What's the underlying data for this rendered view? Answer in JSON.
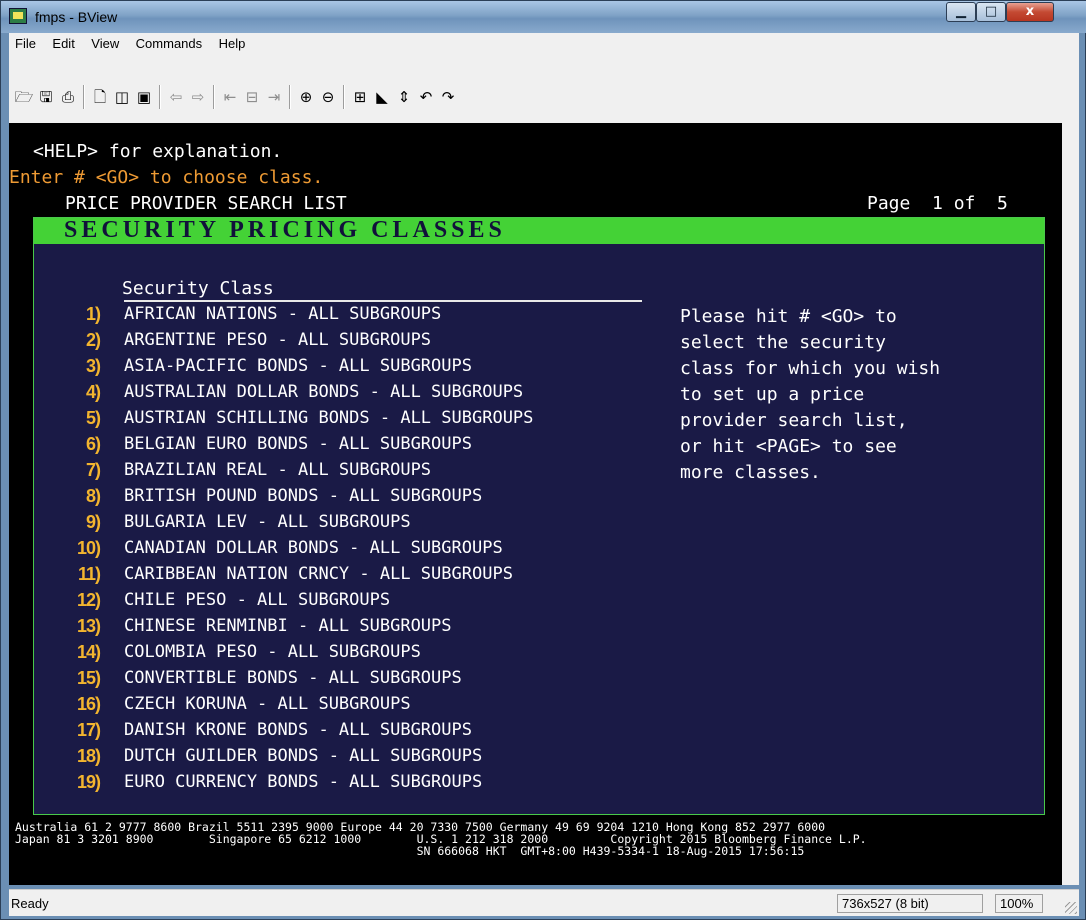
{
  "window": {
    "title": "fmps - BView",
    "minimize": "▁",
    "maximize": "□",
    "close": "x"
  },
  "menu": [
    "File",
    "Edit",
    "View",
    "Commands",
    "Help"
  ],
  "toolbar": {
    "icons": [
      {
        "name": "open-folder-icon",
        "glyph": "🗁",
        "disabled": false
      },
      {
        "name": "save-icon",
        "glyph": "🖫",
        "disabled": false
      },
      {
        "name": "print-icon",
        "glyph": "⎙",
        "disabled": false
      },
      {
        "name": "new-page-icon",
        "glyph": "🗋",
        "disabled": false
      },
      {
        "name": "window-icon",
        "glyph": "◫",
        "disabled": false
      },
      {
        "name": "fullscreen-icon",
        "glyph": "▣",
        "disabled": false
      },
      {
        "name": "back-icon",
        "glyph": "⇦",
        "disabled": true
      },
      {
        "name": "forward-icon",
        "glyph": "⇨",
        "disabled": true
      },
      {
        "name": "first-page-icon",
        "glyph": "⇤",
        "disabled": true
      },
      {
        "name": "page-icon",
        "glyph": "⊟",
        "disabled": true
      },
      {
        "name": "last-page-icon",
        "glyph": "⇥",
        "disabled": true
      },
      {
        "name": "zoom-in-icon",
        "glyph": "⊕",
        "disabled": false
      },
      {
        "name": "zoom-out-icon",
        "glyph": "⊖",
        "disabled": false
      },
      {
        "name": "resize-icon",
        "glyph": "⊞",
        "disabled": false
      },
      {
        "name": "pointer-icon",
        "glyph": "◣",
        "disabled": false
      },
      {
        "name": "scroll-icon",
        "glyph": "⇕",
        "disabled": false
      },
      {
        "name": "undo-icon",
        "glyph": "↶",
        "disabled": false
      },
      {
        "name": "redo-icon",
        "glyph": "↷",
        "disabled": false
      }
    ]
  },
  "screen": {
    "help_line": "<HELP> for explanation.",
    "enter_line": "Enter # <GO> to choose class.",
    "list_title": "PRICE PROVIDER SEARCH LIST",
    "page_info": "Page  1 of  5",
    "panel_title": "SECURITY PRICING CLASSES",
    "column_header": "Security Class",
    "items": [
      {
        "num": "1)",
        "label": "AFRICAN NATIONS - ALL SUBGROUPS"
      },
      {
        "num": "2)",
        "label": "ARGENTINE PESO - ALL SUBGROUPS"
      },
      {
        "num": "3)",
        "label": "ASIA-PACIFIC BONDS - ALL SUBGROUPS"
      },
      {
        "num": "4)",
        "label": "AUSTRALIAN DOLLAR BONDS - ALL SUBGROUPS"
      },
      {
        "num": "5)",
        "label": "AUSTRIAN SCHILLING BONDS - ALL SUBGROUPS"
      },
      {
        "num": "6)",
        "label": "BELGIAN EURO BONDS - ALL SUBGROUPS"
      },
      {
        "num": "7)",
        "label": "BRAZILIAN REAL - ALL SUBGROUPS"
      },
      {
        "num": "8)",
        "label": "BRITISH POUND BONDS - ALL SUBGROUPS"
      },
      {
        "num": "9)",
        "label": "BULGARIA LEV - ALL SUBGROUPS"
      },
      {
        "num": "10)",
        "label": "CANADIAN DOLLAR BONDS - ALL SUBGROUPS"
      },
      {
        "num": "11)",
        "label": "CARIBBEAN NATION CRNCY - ALL SUBGROUPS"
      },
      {
        "num": "12)",
        "label": "CHILE PESO - ALL SUBGROUPS"
      },
      {
        "num": "13)",
        "label": "CHINESE RENMINBI - ALL SUBGROUPS"
      },
      {
        "num": "14)",
        "label": "COLOMBIA PESO - ALL SUBGROUPS"
      },
      {
        "num": "15)",
        "label": "CONVERTIBLE BONDS - ALL SUBGROUPS"
      },
      {
        "num": "16)",
        "label": "CZECH KORUNA - ALL SUBGROUPS"
      },
      {
        "num": "17)",
        "label": "DANISH KRONE BONDS - ALL SUBGROUPS"
      },
      {
        "num": "18)",
        "label": "DUTCH GUILDER BONDS - ALL SUBGROUPS"
      },
      {
        "num": "19)",
        "label": "EURO CURRENCY BONDS - ALL SUBGROUPS"
      }
    ],
    "help_text": [
      "Please hit # <GO> to",
      "select the security",
      "class for which you wish",
      "to set up a price",
      "provider search list,",
      "or hit <PAGE> to see",
      "more classes."
    ],
    "footer_lines": [
      "Australia 61 2 9777 8600 Brazil 5511 2395 9000 Europe 44 20 7330 7500 Germany 49 69 9204 1210 Hong Kong 852 2977 6000",
      "Japan 81 3 3201 8900        Singapore 65 6212 1000        U.S. 1 212 318 2000         Copyright 2015 Bloomberg Finance L.P.",
      "                                                          SN 666068 HKT  GMT+8:00 H439-5334-1 18-Aug-2015 17:56:15"
    ]
  },
  "status": {
    "text": "Ready",
    "resolution": "736x527 (8 bit)",
    "zoom": "100%"
  }
}
